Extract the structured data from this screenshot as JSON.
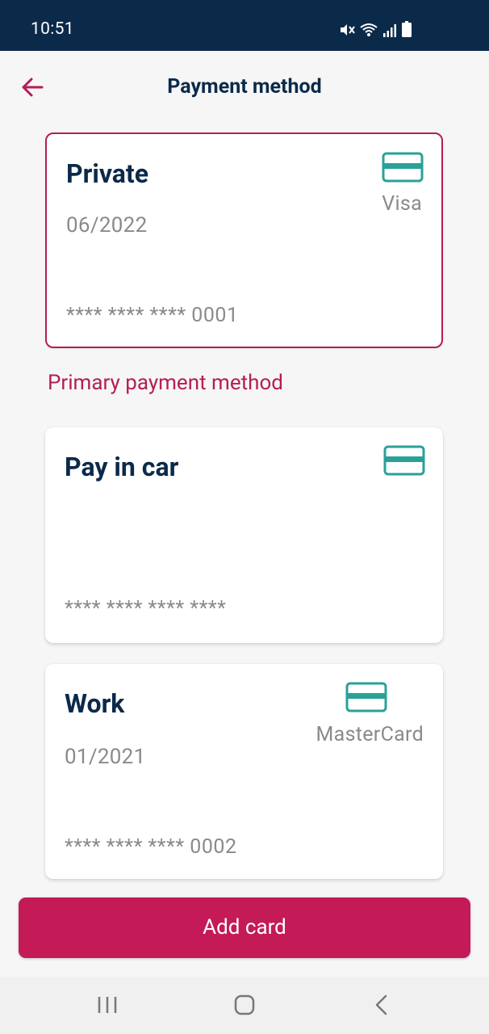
{
  "status_bar": {
    "time": "10:51",
    "icons": [
      "mute-icon",
      "wifi-icon",
      "signal-icon",
      "battery-icon"
    ]
  },
  "header": {
    "title": "Payment method",
    "back_icon": "arrow-left-icon"
  },
  "cards": [
    {
      "name": "Private",
      "expiry": "06/2022",
      "brand": "Visa",
      "number": "**** **** **** 0001",
      "selected": true
    },
    {
      "name": "Pay in car",
      "expiry": "",
      "brand": "",
      "number": "**** **** **** ****",
      "selected": false
    },
    {
      "name": "Work",
      "expiry": "01/2021",
      "brand": "MasterCard",
      "number": "**** **** **** 0002",
      "selected": false
    }
  ],
  "primary_label": "Primary payment method",
  "add_card_button": "Add card",
  "nav_bar": {
    "buttons": [
      "recent-apps-icon",
      "home-icon",
      "back-icon"
    ]
  },
  "colors": {
    "status_bar": "#0b2a4a",
    "accent": "#b51d57",
    "button": "#c41a57",
    "card_icon": "#2aa198",
    "title": "#0b2a4a",
    "muted_text": "#8a8a8a"
  }
}
